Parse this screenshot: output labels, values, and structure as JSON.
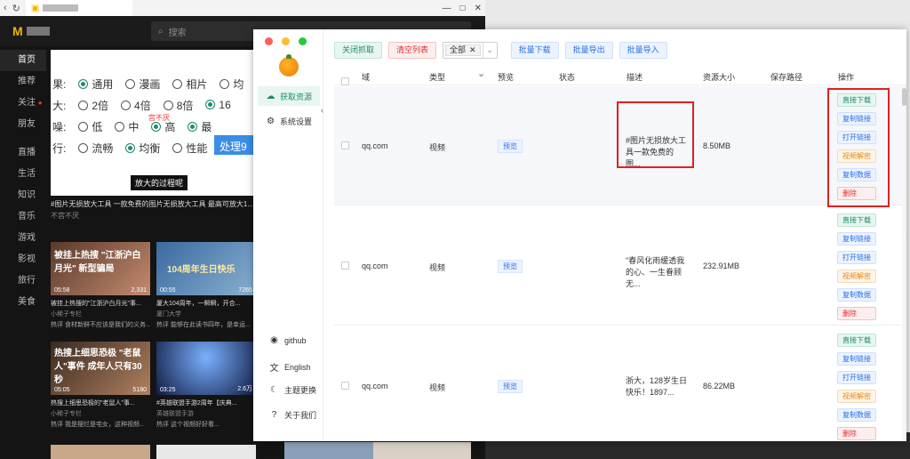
{
  "background_browser": {
    "search_placeholder": "搜索",
    "nav": [
      "首页",
      "推荐",
      "关注",
      "朋友",
      "直播",
      "生活",
      "知识",
      "音乐",
      "游戏",
      "影视",
      "旅行",
      "美食"
    ],
    "feature": {
      "rows": [
        {
          "prefix": "果:",
          "options": [
            "通用",
            "漫画",
            "相片",
            "均"
          ]
        },
        {
          "prefix": "大:",
          "options": [
            "2倍",
            "4倍",
            "8倍",
            "16"
          ]
        },
        {
          "prefix": "噪:",
          "options": [
            "低",
            "中",
            "高",
            "最"
          ]
        },
        {
          "prefix": "行:",
          "options": [
            "流畅",
            "均衡",
            "性能"
          ]
        }
      ],
      "subtitle": "宫不厌",
      "processing_label": "处理9",
      "caption": "放大的过程呢",
      "title": "#图片无损放大工具 一款免费的图片无损放大工具 最高可放大1...",
      "sub": "不宫不厌"
    },
    "cards": [
      {
        "title": "被挂上热搜 \"江浙沪白月光\" 新型骗局",
        "time": "05:58",
        "stat": "2,331",
        "caption": "被挂上热搜的\"江浙沪白月光\"事...",
        "author": "小稀子专栏",
        "meta": "热评 食材新鲜不应该是我们的义务..."
      },
      {
        "title": "104周年生日快乐",
        "time": "00:55",
        "stat": "7265",
        "caption": "厦大104周年，一瞬瞬，开合...",
        "author": "厦门大学",
        "meta": "热评 能够在此读书四年，是幸运..."
      },
      {
        "title": "热搜上细思恐极 \"老鼠人\"事件 成年人只有30秒",
        "time": "05:05",
        "stat": "5180",
        "caption": "热搜上细思恐极的\"老鼠人\"事...",
        "author": "小稀子专栏",
        "meta": "热评 我是摆烂是宅女，这种视频..."
      },
      {
        "title": "",
        "time": "03:25",
        "stat": "2.6万",
        "caption": "#英雄联盟手游2周年【庆典...",
        "author": "英雄联盟手游",
        "meta": "热评 这个视频好好看..."
      }
    ]
  },
  "app": {
    "sidebar": {
      "items": [
        {
          "label": "获取资源",
          "icon": "cloud-icon"
        },
        {
          "label": "系统设置",
          "icon": "gear-icon"
        }
      ],
      "footer": [
        {
          "label": "github",
          "icon": "github-icon"
        },
        {
          "label": "English",
          "icon": "translate-icon"
        },
        {
          "label": "主题更换",
          "icon": "moon-icon"
        },
        {
          "label": "关于我们",
          "icon": "question-icon"
        }
      ]
    },
    "toolbar": {
      "close_capture": "关闭抓取",
      "clear_list": "清空列表",
      "filter_tag": "全部",
      "batch_download": "批量下载",
      "batch_export": "批量导出",
      "batch_import": "批量导入"
    },
    "columns": [
      "域",
      "类型",
      "预览",
      "状态",
      "描述",
      "资源大小",
      "保存路径",
      "操作"
    ],
    "rows": [
      {
        "domain": "qq.com",
        "type": "视频",
        "preview": "预览",
        "status": "",
        "desc": "#图片无损放大工具一款免费的图...",
        "size": "8.50MB",
        "path": ""
      },
      {
        "domain": "qq.com",
        "type": "视频",
        "preview": "预览",
        "status": "",
        "desc": "\"春风化雨缓透我的心、一生眷顾无...",
        "size": "232.91MB",
        "path": ""
      },
      {
        "domain": "qq.com",
        "type": "视频",
        "preview": "预览",
        "status": "",
        "desc": "浙大，128岁生日快乐！1897...",
        "size": "86.22MB",
        "path": ""
      }
    ],
    "row_actions": [
      "直接下载",
      "复制链接",
      "打开链接",
      "视频解密",
      "复制数据",
      "删除"
    ]
  }
}
